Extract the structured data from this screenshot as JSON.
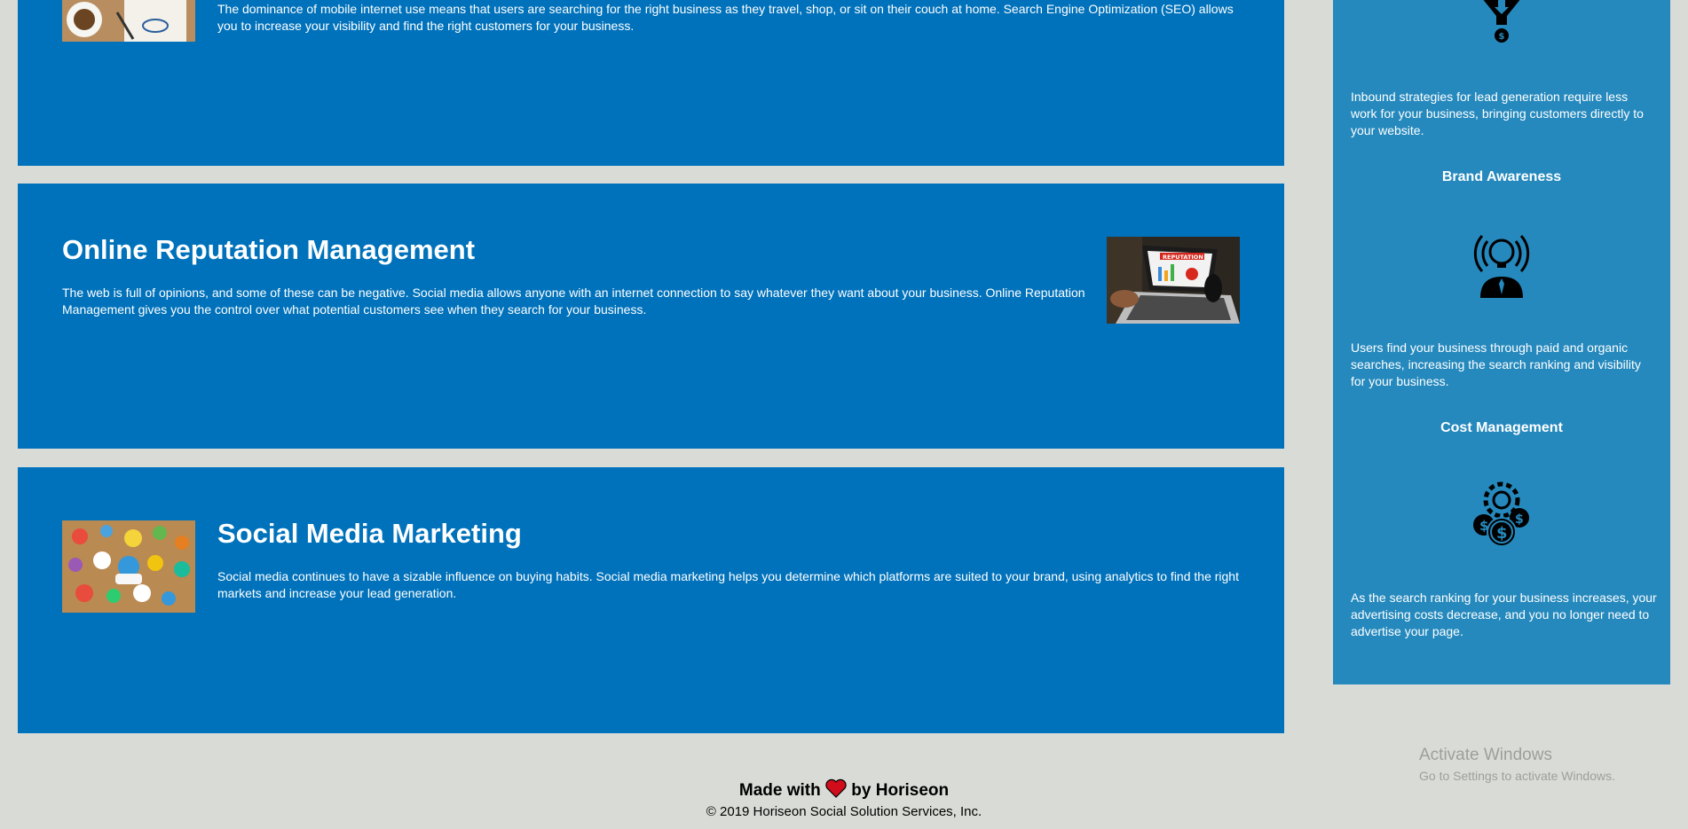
{
  "seo": {
    "text": "The dominance of mobile internet use means that users are searching for the right business as they travel, shop, or sit on their couch at home. Search Engine Optimization (SEO) allows you to increase your visibility and find the right customers for your business."
  },
  "orm": {
    "title": "Online Reputation Management",
    "text": "The web is full of opinions, and some of these can be negative. Social media allows anyone with an internet connection to say whatever they want about your business. Online Reputation Management gives you the control over what potential customers see when they search for your business.",
    "image_label": "REPUTATION"
  },
  "smm": {
    "title": "Social Media Marketing",
    "text": "Social media continues to have a sizable influence on buying habits. Social media marketing helps you determine which platforms are suited to your brand, using analytics to find the right markets and increase your lead generation."
  },
  "benefits": {
    "lead_text": "Inbound strategies for lead generation require less work for your business, bringing customers directly to your website.",
    "brand_title": "Brand Awareness",
    "brand_text": "Users find your business through paid and organic searches, increasing the search ranking and visibility for your business.",
    "cost_title": "Cost Management",
    "cost_text": "As the search ranking for your business increases, your advertising costs decrease, and you no longer need to advertise your page."
  },
  "footer": {
    "made_with": "Made with",
    "by": "by Horiseon",
    "copyright": "© 2019 Horiseon Social Solution Services, Inc."
  },
  "windows": {
    "activate": "Activate Windows",
    "goto": "Go to Settings to activate Windows."
  },
  "icons": {
    "funnel": "funnel-dollar-icon",
    "brand": "lightbulb-person-icon",
    "cost": "gear-dollar-icon",
    "heart": "heart-icon"
  },
  "colors": {
    "page_bg": "#d9dcd6",
    "section_bg": "#0072bb",
    "sidebar_bg": "#2589bd",
    "heart": "#d10d1c"
  }
}
